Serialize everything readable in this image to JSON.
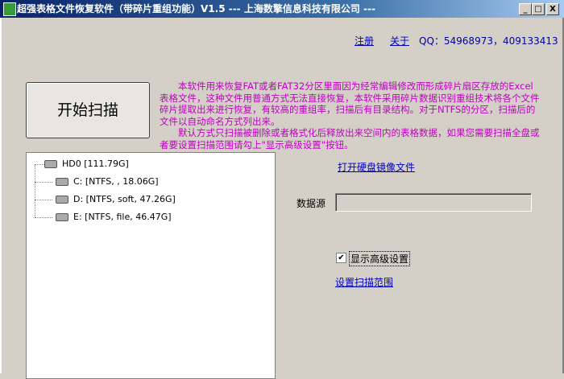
{
  "window": {
    "title": "超强表格文件恢复软件（带碎片重组功能）V1.5  ---  上海数擎信息科技有限公司  ---",
    "minimize": "_",
    "maximize": "□",
    "close": "X"
  },
  "header": {
    "register": "注册",
    "about": "关于",
    "qq": "QQ：54968973，409133413"
  },
  "start_button": "开始扫描",
  "description": {
    "p1": "本软件用来恢复FAT或者FAT32分区里面因为经常编辑修改而形成碎片扇区存放的Excel表格文件，这种文件用普通方式无法直接恢复，本软件采用碎片数据识别重组技术将各个文件碎片提取出来进行恢复，有较高的重组率，扫描后有目录结构。对于NTFS的分区，扫描后的文件以自动命名方式列出来。",
    "p2": "默认方式只扫描被删除或者格式化后释放出来空间内的表格数据，如果您需要扫描全盘或者要设置扫描范围请勾上\"显示高级设置\"按钮。"
  },
  "tree": [
    {
      "label": "HD0   [111.79G]"
    },
    {
      "label": "C:   [NTFS, , 18.06G]"
    },
    {
      "label": "D:   [NTFS, soft, 47.26G]"
    },
    {
      "label": "E:   [NTFS, file, 46.47G]"
    }
  ],
  "right": {
    "open_image": "打开硬盘镜像文件",
    "source_label": "数据源",
    "source_value": "",
    "advanced_label": "显示高级设置",
    "advanced_checked": true,
    "check_mark": "✔",
    "scan_range": "设置扫描范围"
  }
}
